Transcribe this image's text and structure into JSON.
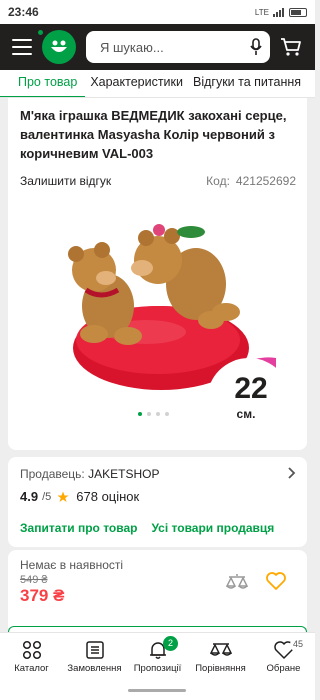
{
  "status": {
    "time": "23:46",
    "signal": "LTE",
    "battery": "50"
  },
  "header": {
    "search_placeholder": "Я шукаю..."
  },
  "tabs": [
    {
      "label": "Про товар",
      "active": true
    },
    {
      "label": "Характеристики",
      "active": false
    },
    {
      "label": "Відгуки та питання",
      "active": false
    }
  ],
  "product": {
    "title": "М'яка іграшка ВЕДМЕДИК закохані серце, валентинка Masyasha Колір червоний з коричневим VAL-003",
    "leave_review": "Залишити відгук",
    "code_label": "Код:",
    "code_value": "421252692",
    "size_badge_number": "22",
    "size_badge_unit": "см.",
    "gallery": {
      "total": 4,
      "active_index": 0
    }
  },
  "seller": {
    "label": "Продавець:",
    "name": "JAKETSHOP",
    "rating": "4.9",
    "rating_max": "/5",
    "reviews": "678 оцінок",
    "ask_link": "Запитати про товар",
    "all_goods_link": "Усі товари продавця"
  },
  "price": {
    "availability": "Немає в наявності",
    "old": "549 ₴",
    "new": "379 ₴"
  },
  "bottom_nav": [
    {
      "label": "Каталог",
      "icon": "catalog-icon"
    },
    {
      "label": "Замовлення",
      "icon": "orders-icon"
    },
    {
      "label": "Пропозиції",
      "icon": "bell-icon",
      "badge": "2"
    },
    {
      "label": "Порівняння",
      "icon": "compare-icon"
    },
    {
      "label": "Обране",
      "icon": "heart-icon",
      "badge": "45"
    }
  ],
  "colors": {
    "accent": "#00a046",
    "price": "#f84147",
    "header": "#221f1f",
    "star": "#ffa900"
  }
}
